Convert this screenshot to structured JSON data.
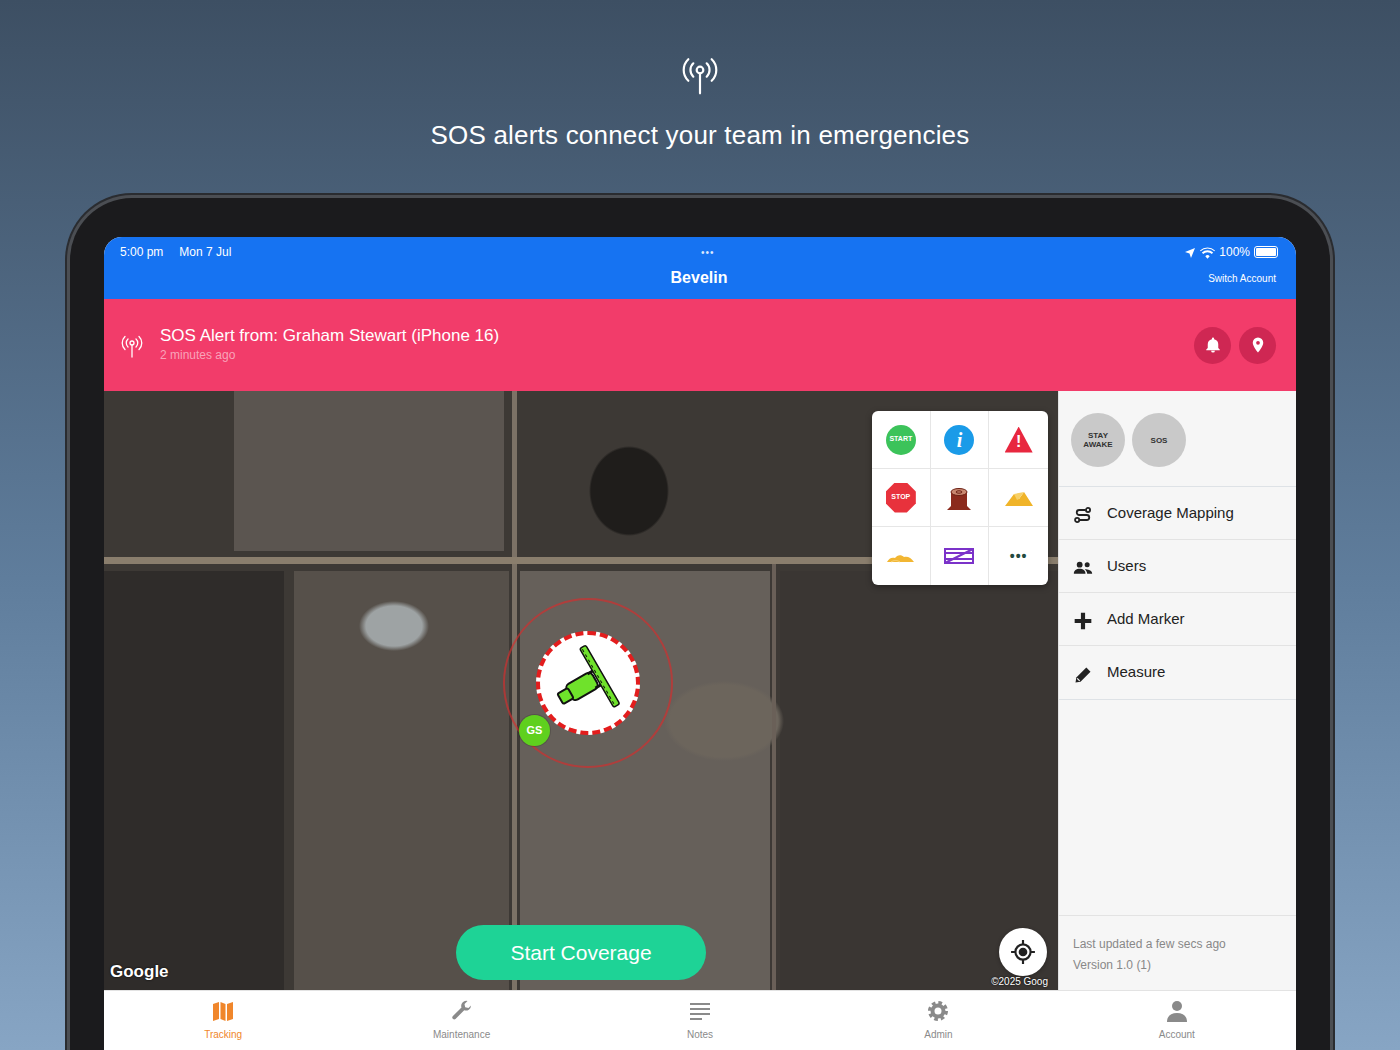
{
  "headline": {
    "text": "SOS alerts connect your team in emergencies"
  },
  "status_bar": {
    "time": "5:00 pm",
    "date": "Mon 7 Jul",
    "dots": "•••",
    "battery": "100%",
    "battery_level": 1
  },
  "app_bar": {
    "title": "Bevelin",
    "action": "Switch Account"
  },
  "alert": {
    "title": "SOS Alert from: Graham Stewart (iPhone 16)",
    "time": "2 minutes ago"
  },
  "map": {
    "attribution": "Google",
    "copyright": "©2025 Goog",
    "vehicle": {
      "badge": "GS"
    },
    "start_button": "Start Coverage",
    "markers": [
      {
        "kind": "start",
        "label": "START"
      },
      {
        "kind": "info",
        "label": "i"
      },
      {
        "kind": "warning",
        "label": "!"
      },
      {
        "kind": "stop",
        "label": "STOP"
      },
      {
        "kind": "stump"
      },
      {
        "kind": "hill"
      },
      {
        "kind": "sand"
      },
      {
        "kind": "fence"
      },
      {
        "kind": "more",
        "label": "•••"
      }
    ]
  },
  "sidebar": {
    "quick_buttons": [
      {
        "label": "STAY AWAKE"
      },
      {
        "label": "SOS"
      }
    ],
    "items": [
      {
        "label": "Coverage Mapping"
      },
      {
        "label": "Users"
      },
      {
        "label": "Add Marker"
      },
      {
        "label": "Measure"
      }
    ],
    "footer": {
      "updated": "Last updated a few secs ago",
      "version": "Version 1.0 (1)"
    }
  },
  "tabs": [
    {
      "label": "Tracking",
      "selected": true
    },
    {
      "label": "Maintenance",
      "selected": false
    },
    {
      "label": "Notes",
      "selected": false
    },
    {
      "label": "Admin",
      "selected": false
    },
    {
      "label": "Account",
      "selected": false
    }
  ]
}
